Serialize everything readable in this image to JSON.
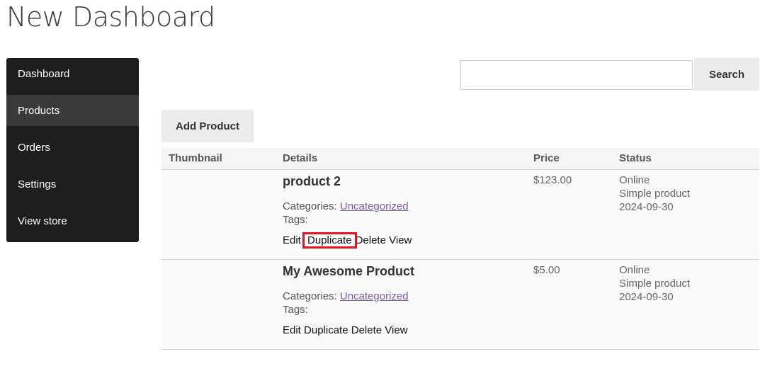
{
  "page_title": "New Dashboard",
  "sidebar": {
    "items": [
      {
        "label": "Dashboard",
        "active": false
      },
      {
        "label": "Products",
        "active": true
      },
      {
        "label": "Orders",
        "active": false
      },
      {
        "label": "Settings",
        "active": false
      },
      {
        "label": "View store",
        "active": false
      }
    ]
  },
  "search": {
    "value": "",
    "placeholder": "",
    "button_label": "Search"
  },
  "toolbar": {
    "add_product_label": "Add Product"
  },
  "table": {
    "headers": {
      "thumbnail": "Thumbnail",
      "details": "Details",
      "price": "Price",
      "status": "Status"
    },
    "rows": [
      {
        "name": "product 2",
        "categories_label": "Categories: ",
        "category": "Uncategorized",
        "tags_label": "Tags:",
        "actions": {
          "edit": "Edit",
          "duplicate": "Duplicate",
          "delete": "Delete",
          "view": "View"
        },
        "price": "$123.00",
        "status": "Online",
        "type": "Simple product",
        "date": "2024-09-30"
      },
      {
        "name": "My Awesome Product",
        "categories_label": "Categories: ",
        "category": "Uncategorized",
        "tags_label": "Tags:",
        "actions": {
          "edit": "Edit",
          "duplicate": "Duplicate",
          "delete": "Delete",
          "view": "View"
        },
        "price": "$5.00",
        "status": "Online",
        "type": "Simple product",
        "date": "2024-09-30"
      }
    ]
  },
  "colors": {
    "sidebar_bg": "#1e1e1e",
    "sidebar_active": "#3a3a3a",
    "link": "#7b5aa6",
    "highlight": "#e3141b"
  }
}
